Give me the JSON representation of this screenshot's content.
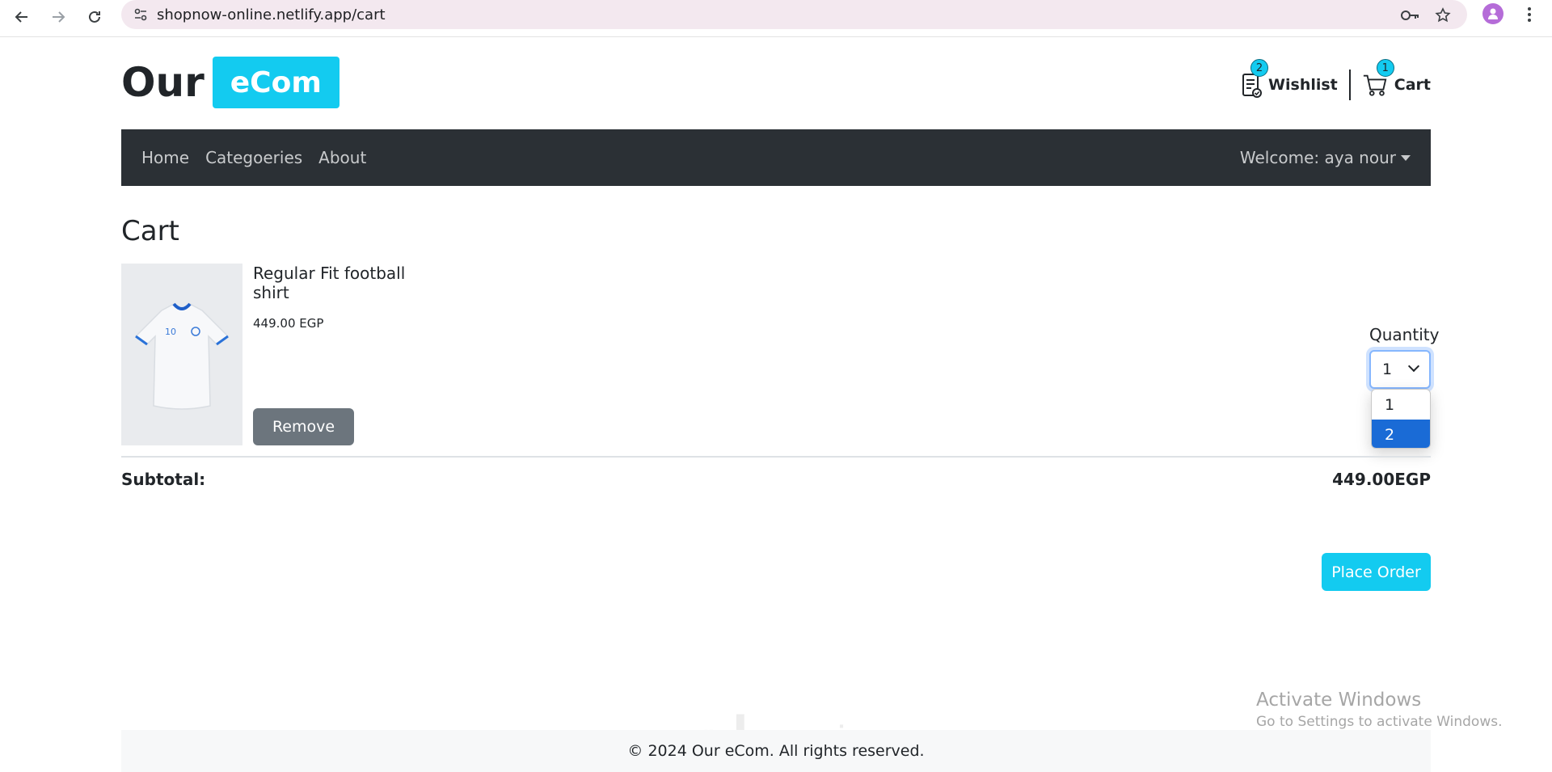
{
  "browser": {
    "url": "shopnow-online.netlify.app/cart"
  },
  "logo": {
    "part1": "Our",
    "part2": "eCom"
  },
  "header": {
    "wishlist": {
      "label": "Wishlist",
      "count": "2"
    },
    "cart": {
      "label": "Cart",
      "count": "1"
    }
  },
  "navbar": {
    "links": [
      "Home",
      "Categoeries",
      "About"
    ],
    "welcome": "Welcome: aya nour"
  },
  "cart": {
    "title": "Cart",
    "item": {
      "name": "Regular Fit football shirt",
      "price": "449.00 EGP",
      "remove_label": "Remove",
      "image_icon": "football-shirt"
    },
    "quantity": {
      "label": "Quantity",
      "selected": "1",
      "options": [
        "1",
        "2"
      ],
      "highlighted": "2"
    },
    "subtotal_label": "Subtotal:",
    "subtotal_value": "449.00EGP",
    "place_order_label": "Place Order"
  },
  "watermark": {
    "line1": "Activate Windows",
    "line2": "Go to Settings to activate Windows.",
    "arabic": "خمسات"
  },
  "footer": {
    "copyright": "© 2024 Our eCom. All rights reserved."
  },
  "colors": {
    "brand": "#13cbf0",
    "navbar": "#2b3035",
    "remove": "#6c757d",
    "option_highlight": "#1a6bd6"
  }
}
